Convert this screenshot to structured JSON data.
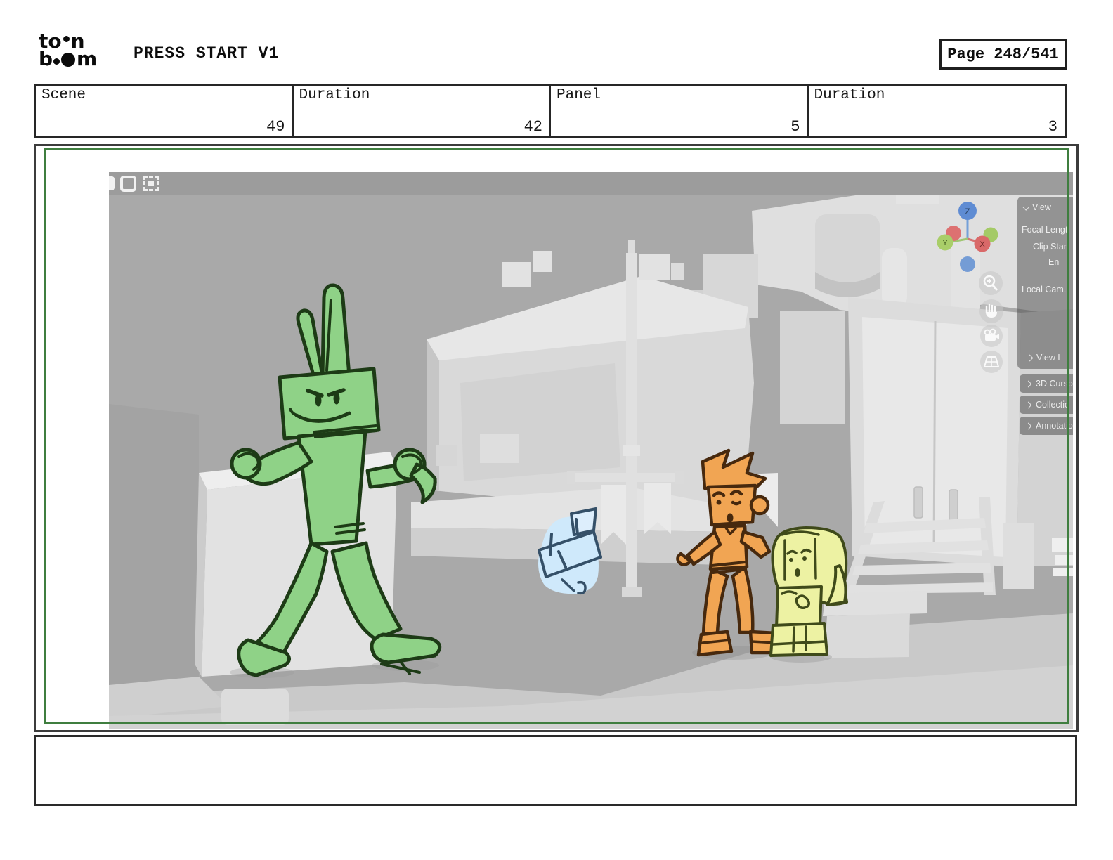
{
  "header": {
    "logo": {
      "line1_left": "to",
      "line1_right": "n",
      "line2_left": "b",
      "line2_right": "m"
    },
    "title": "PRESS START V1",
    "page_label": "Page 248/541"
  },
  "info_table": {
    "cells": [
      {
        "label": "Scene",
        "value": "49"
      },
      {
        "label": "Duration",
        "value": "42"
      },
      {
        "label": "Panel",
        "value": "5"
      },
      {
        "label": "Duration",
        "value": "3"
      }
    ]
  },
  "viewport": {
    "sidebar": {
      "view_label": "View",
      "focal_label": "Focal Lengt",
      "clip_start_label": "Clip Star",
      "clip_end_label": "En",
      "local_cam_label": "Local Cam.",
      "view_lock_label": "View L",
      "sections": [
        "3D Curso",
        "Collectio",
        "Annotatio"
      ]
    },
    "gizmo": {
      "z": "Z",
      "y": "Y",
      "x": "X"
    },
    "tool_icons": [
      "zoom-icon",
      "pan-hand-icon",
      "camera-icon",
      "grid-icon"
    ]
  },
  "caption": {
    "text": ""
  },
  "colors": {
    "frame_green": "#3f7e3f",
    "viewport_bg": "#a9a9a9",
    "character_green": "#8fd287",
    "character_orange": "#f1a553",
    "character_yellow": "#edf2a3",
    "prop_blue": "#cfe9fb"
  }
}
